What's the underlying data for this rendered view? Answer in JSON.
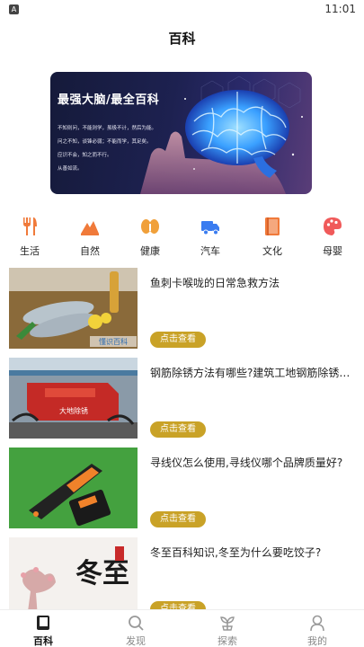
{
  "status_bar": {
    "app_badge": "A",
    "time": "11:01"
  },
  "header": {
    "title": "百科"
  },
  "banner": {
    "title": "最强大脑/最全百科",
    "lines": [
      "不知则问，不能则学，虽极不计，然后为能。",
      "问之不知，谈锋必弱；不能而学，其足矣。",
      "应识不会，知之而不行。",
      "从善如流。"
    ],
    "colors": {
      "bg": "#1d2150",
      "brain": "#3aa0ff"
    }
  },
  "categories": [
    {
      "label": "生活",
      "icon": "utensils-icon",
      "color": "#f07a3a"
    },
    {
      "label": "自然",
      "icon": "mountain-icon",
      "color": "#f07a3a"
    },
    {
      "label": "健康",
      "icon": "kidney-icon",
      "color": "#f0a03a"
    },
    {
      "label": "汽车",
      "icon": "truck-icon",
      "color": "#3a7cf0"
    },
    {
      "label": "文化",
      "icon": "book-icon",
      "color": "#f07a3a"
    },
    {
      "label": "母婴",
      "icon": "palette-icon",
      "color": "#f05a5a"
    }
  ],
  "articles": [
    {
      "title": "鱼刺卡喉咙的日常急救方法",
      "button": "点击查看",
      "thumb": "fish-thumbnail",
      "thumb_caption": "懂识百科"
    },
    {
      "title": "钢筋除锈方法有哪些?建筑工地钢筋除锈…",
      "button": "点击查看",
      "thumb": "rust-removal-machine-thumbnail",
      "thumb_caption": "大地除锈"
    },
    {
      "title": "寻线仪怎么使用,寻线仪哪个品牌质量好?",
      "button": "点击查看",
      "thumb": "cable-tracer-thumbnail",
      "thumb_caption": ""
    },
    {
      "title": "冬至百科知识,冬至为什么要吃饺子?",
      "button": "点击查看",
      "thumb": "winter-solstice-thumbnail",
      "thumb_caption": "冬至"
    }
  ],
  "bottom_nav": [
    {
      "label": "百科",
      "icon": "book-icon",
      "active": true
    },
    {
      "label": "发现",
      "icon": "search-icon",
      "active": false
    },
    {
      "label": "探索",
      "icon": "sprout-icon",
      "active": false
    },
    {
      "label": "我的",
      "icon": "user-icon",
      "active": false
    }
  ],
  "colors": {
    "accent_button": "#c9a227",
    "active_nav": "#111111",
    "inactive_nav": "#888888"
  }
}
